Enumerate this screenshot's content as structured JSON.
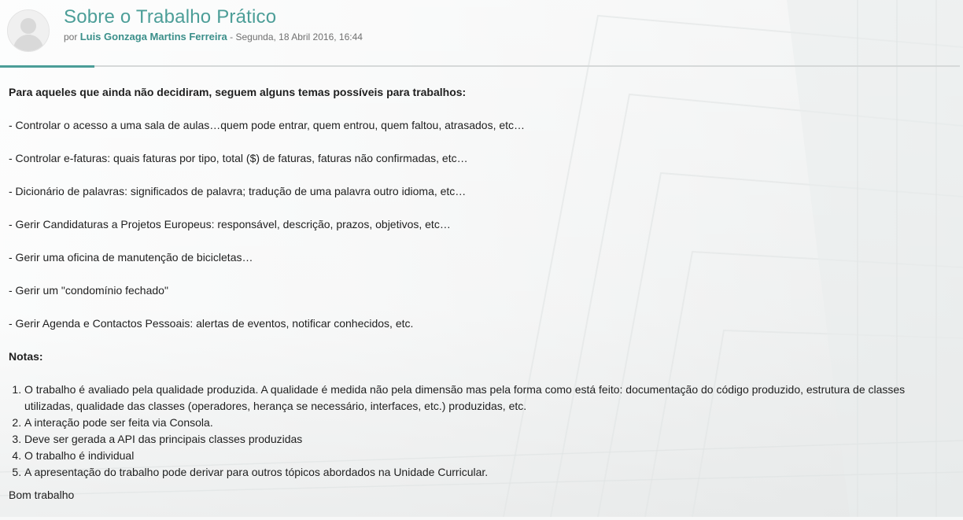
{
  "post": {
    "title": "Sobre o Trabalho Prático",
    "by_prefix": "por",
    "author": "Luis Gonzaga Martins Ferreira",
    "date": "- Segunda, 18 Abril 2016, 16:44"
  },
  "content": {
    "intro": "Para aqueles que ainda não decidiram, seguem alguns temas possíveis para trabalhos:",
    "themes": [
      "- Controlar o acesso a uma sala de aulas…quem pode entrar, quem entrou, quem faltou, atrasados, etc…",
      "- Controlar e-faturas: quais faturas por tipo, total ($) de faturas, faturas não confirmadas, etc…",
      "- Dicionário de palavras: significados de palavra; tradução de uma palavra outro idioma, etc…",
      "- Gerir Candidaturas a Projetos Europeus: responsável, descrição, prazos, objetivos, etc…",
      "- Gerir uma oficina de manutenção de bicicletas…",
      "- Gerir um \"condomínio fechado\"",
      "- Gerir Agenda e Contactos Pessoais: alertas de eventos, notificar conhecidos, etc."
    ],
    "notes_title": "Notas:",
    "notes": [
      "O trabalho é avaliado pela qualidade produzida. A qualidade é medida não pela dimensão mas pela forma como está feito: documentação do código produzido, estrutura de classes utilizadas, qualidade das classes (operadores, herança se necessário, interfaces, etc.) produzidas, etc.",
      "A interação pode ser feita via Consola.",
      "Deve ser gerada a API das principais classes produzidas",
      "O trabalho é individual",
      "A apresentação do trabalho pode derivar para outros tópicos abordados na Unidade Curricular."
    ],
    "closing": "Bom trabalho"
  },
  "icons": {
    "avatar": "user-avatar-icon"
  },
  "colors": {
    "accent": "#4c9e98",
    "author": "#3b8f8a",
    "divider": "#d6d9d9"
  }
}
